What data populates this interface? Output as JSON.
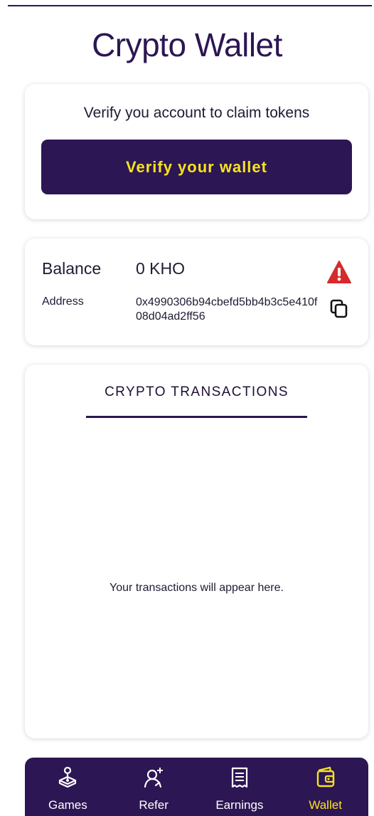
{
  "header": {
    "title": "Crypto Wallet"
  },
  "verify": {
    "message": "Verify you account to claim  tokens",
    "button_label": "Verify your wallet"
  },
  "wallet": {
    "balance_label": "Balance",
    "balance_value": "0 KHO",
    "address_label": "Address",
    "address_value": "0x4990306b94cbefd5bb4b3c5e410f08d04ad2ff56",
    "warning_icon": "warning-icon",
    "copy_icon": "copy-icon"
  },
  "transactions": {
    "title": "CRYPTO TRANSACTIONS",
    "empty_message": "Your transactions will appear here."
  },
  "nav": {
    "items": [
      {
        "label": "Games",
        "icon": "joystick-icon"
      },
      {
        "label": "Refer",
        "icon": "refer-user-icon"
      },
      {
        "label": "Earnings",
        "icon": "receipt-icon"
      },
      {
        "label": "Wallet",
        "icon": "wallet-icon"
      }
    ],
    "active": "Wallet"
  },
  "colors": {
    "primary": "#2c1654",
    "accent": "#f7e41c",
    "warning": "#d62b2b"
  }
}
